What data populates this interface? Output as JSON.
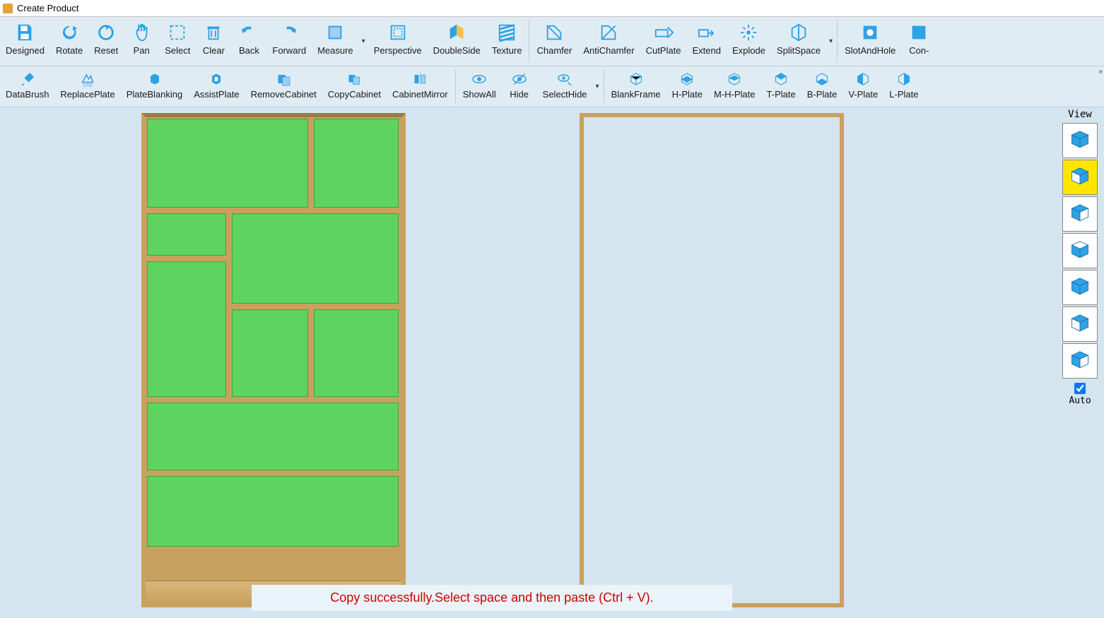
{
  "window": {
    "title": "Create Product"
  },
  "toolbar1": [
    {
      "id": "designed",
      "label": "Designed",
      "icon": "save"
    },
    {
      "id": "rotate",
      "label": "Rotate",
      "icon": "rotate"
    },
    {
      "id": "reset",
      "label": "Reset",
      "icon": "reset"
    },
    {
      "id": "pan",
      "label": "Pan",
      "icon": "pan"
    },
    {
      "id": "select",
      "label": "Select",
      "icon": "select"
    },
    {
      "id": "clear",
      "label": "Clear",
      "icon": "trash"
    },
    {
      "id": "back",
      "label": "Back",
      "icon": "undo"
    },
    {
      "id": "forward",
      "label": "Forward",
      "icon": "redo"
    },
    {
      "id": "measure",
      "label": "Measure",
      "icon": "measure",
      "dropdown": true
    },
    {
      "id": "perspective",
      "label": "Perspective",
      "icon": "persp"
    },
    {
      "id": "doubleside",
      "label": "DoubleSide",
      "icon": "double"
    },
    {
      "id": "texture",
      "label": "Texture",
      "icon": "texture"
    },
    {
      "id": "chamfer",
      "label": "Chamfer",
      "icon": "chamfer",
      "sep_before": true
    },
    {
      "id": "antichamfer",
      "label": "AntiChamfer",
      "icon": "antichamfer"
    },
    {
      "id": "cutplate",
      "label": "CutPlate",
      "icon": "cutplate"
    },
    {
      "id": "extend",
      "label": "Extend",
      "icon": "extend"
    },
    {
      "id": "explode",
      "label": "Explode",
      "icon": "explode"
    },
    {
      "id": "splitspace",
      "label": "SplitSpace",
      "icon": "splitspace",
      "dropdown": true
    },
    {
      "id": "slotandhole",
      "label": "SlotAndHole",
      "icon": "slot",
      "sep_before": true
    },
    {
      "id": "con",
      "label": "Con-",
      "icon": "con"
    }
  ],
  "toolbar2": [
    {
      "id": "databrush",
      "label": "DataBrush",
      "icon": "brush"
    },
    {
      "id": "replaceplate",
      "label": "ReplacePlate",
      "icon": "cad"
    },
    {
      "id": "plateblanking",
      "label": "PlateBlanking",
      "icon": "plateblank"
    },
    {
      "id": "assistplate",
      "label": "AssistPlate",
      "icon": "assist"
    },
    {
      "id": "removecabinet",
      "label": "RemoveCabinet",
      "icon": "removecab"
    },
    {
      "id": "copycabinet",
      "label": "CopyCabinet",
      "icon": "copycab"
    },
    {
      "id": "cabinetmirror",
      "label": "CabinetMirror",
      "icon": "mirror"
    },
    {
      "id": "showall",
      "label": "ShowAll",
      "icon": "eye",
      "sep_before": true
    },
    {
      "id": "hide",
      "label": "Hide",
      "icon": "eyeoff"
    },
    {
      "id": "selecthide",
      "label": "SelectHide",
      "icon": "eyesearch",
      "dropdown": true
    },
    {
      "id": "blankframe",
      "label": "BlankFrame",
      "icon": "cube-outline",
      "sep_before": true
    },
    {
      "id": "hplate",
      "label": "H-Plate",
      "icon": "cube-h"
    },
    {
      "id": "mhplate",
      "label": "M-H-Plate",
      "icon": "cube-mh"
    },
    {
      "id": "tplate",
      "label": "T-Plate",
      "icon": "cube-t"
    },
    {
      "id": "bplate",
      "label": "B-Plate",
      "icon": "cube-b"
    },
    {
      "id": "vplate",
      "label": "V-Plate",
      "icon": "cube-v"
    },
    {
      "id": "lplate",
      "label": "L-Plate",
      "icon": "cube-l"
    }
  ],
  "view": {
    "title": "View",
    "buttons": [
      "iso",
      "front",
      "left",
      "right",
      "top",
      "bottom",
      "back-view"
    ],
    "selected": 1,
    "auto_label": "Auto",
    "auto_checked": true
  },
  "status": {
    "message": "Copy successfully.Select space and then paste (Ctrl + V)."
  },
  "colors": {
    "accent": "#2ea2e6",
    "wood": "#c9a15f",
    "panel": "#5fd35f"
  }
}
